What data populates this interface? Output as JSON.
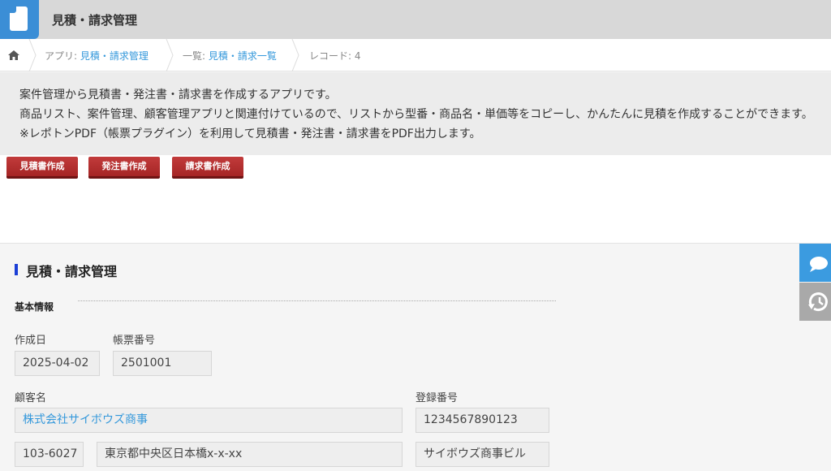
{
  "header": {
    "app_title": "見積・請求管理",
    "icon": "app-document-icon"
  },
  "breadcrumb": {
    "home_icon": "home-icon",
    "app_prefix": "アプリ: ",
    "app_link": "見積・請求管理",
    "list_prefix": "一覧: ",
    "list_link": "見積・請求一覧",
    "record": "レコード: 4"
  },
  "description": {
    "line1": "案件管理から見積書・発注書・請求書を作成するアプリです。",
    "line2": "商品リスト、案件管理、顧客管理アプリと関連付けているので、リストから型番・商品名・単価等をコピーし、かんたんに見積を作成することができます。",
    "line3": "※レポトンPDF（帳票プラグイン）を利用して見積書・発注書・請求書をPDF出力します。"
  },
  "buttons": {
    "estimate": "見積書作成",
    "order": "発注書作成",
    "invoice": "請求書作成"
  },
  "form": {
    "title": "見積・請求管理",
    "section_basic": "基本情報",
    "created_date_label": "作成日",
    "created_date_value": "2025-04-02",
    "doc_number_label": "帳票番号",
    "doc_number_value": "2501001",
    "customer_label": "顧客名",
    "customer_value": "株式会社サイボウズ商事",
    "reg_number_label": "登録番号",
    "reg_number_value": "1234567890123",
    "postal_value": "103-6027",
    "address_value": "東京都中央区日本橋x-x-xx",
    "building_value": "サイボウズ商事ビル"
  },
  "side_tabs": {
    "comment_icon": "comment-icon",
    "history_icon": "history-icon"
  },
  "colors": {
    "accent_blue": "#3b8ed6",
    "link": "#3498db",
    "button_red": "#b22e2e",
    "title_bar": "#1b3fd6"
  }
}
